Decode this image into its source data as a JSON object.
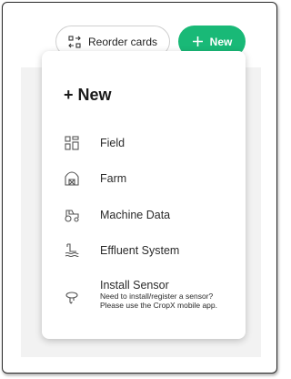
{
  "toolbar": {
    "reorder_label": "Reorder cards",
    "new_label": "New",
    "new_color": "#19b977"
  },
  "menu": {
    "title": "+ New",
    "items": [
      {
        "label": "Field",
        "icon": "grid-layout-icon"
      },
      {
        "label": "Farm",
        "icon": "farm-barn-icon"
      },
      {
        "label": "Machine Data",
        "icon": "tractor-icon"
      },
      {
        "label": "Effluent System",
        "icon": "effluent-system-icon"
      },
      {
        "label": "Install Sensor",
        "icon": "sensor-icon",
        "description": "Need to install/register a sensor? Please use the CropX mobile app."
      }
    ]
  }
}
